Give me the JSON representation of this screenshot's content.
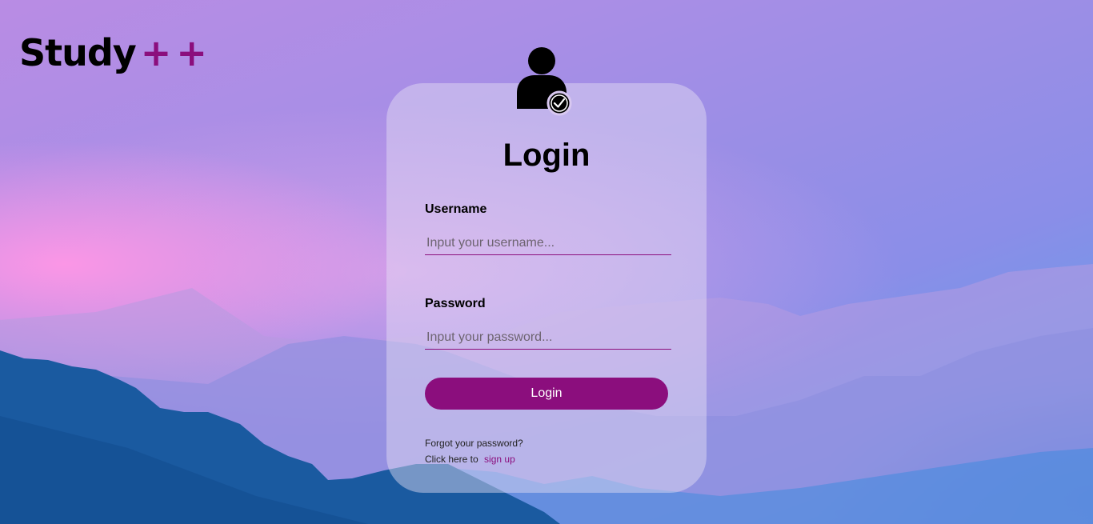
{
  "brand": {
    "name": "Study",
    "suffix": "++"
  },
  "login_card": {
    "title": "Login",
    "avatar_icon": "user-check-icon",
    "username": {
      "label": "Username",
      "value": "",
      "placeholder": "Input your username..."
    },
    "password": {
      "label": "Password",
      "value": "",
      "placeholder": "Input your password..."
    },
    "submit_label": "Login",
    "forgot_text": "Forgot your password?",
    "signup_prefix": "Click here to",
    "signup_link": "sign up"
  },
  "colors": {
    "accent": "#8b0e7d",
    "text": "#000000",
    "button_text": "#ffffff"
  }
}
